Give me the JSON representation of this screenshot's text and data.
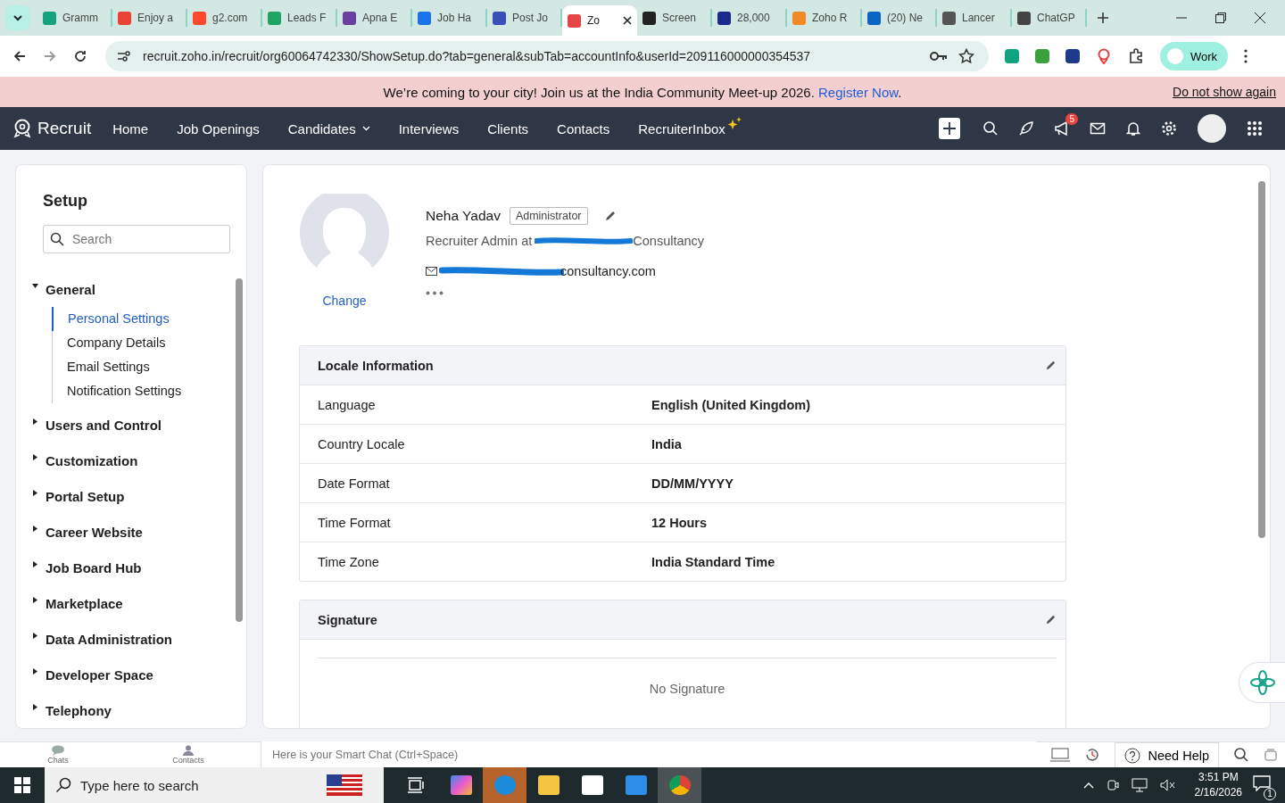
{
  "browser": {
    "tabs": [
      {
        "label": "Gramm",
        "selected": false,
        "color": "#15a37f"
      },
      {
        "label": "Enjoy a",
        "selected": false,
        "color": "#ea4335"
      },
      {
        "label": "g2.com",
        "selected": false,
        "color": "#ff492c"
      },
      {
        "label": "Leads F",
        "selected": false,
        "color": "#1fa463"
      },
      {
        "label": "Apna E",
        "selected": false,
        "color": "#6b3fa0"
      },
      {
        "label": "Job Ha",
        "selected": false,
        "color": "#1a73e8"
      },
      {
        "label": "Post Jo",
        "selected": false,
        "color": "#3b4fb8"
      },
      {
        "label": "Zo",
        "selected": true,
        "color": "#e64545"
      },
      {
        "label": "Screen",
        "selected": false,
        "color": "#222222"
      },
      {
        "label": "28,000",
        "selected": false,
        "color": "#1a2a8a"
      },
      {
        "label": "Zoho R",
        "selected": false,
        "color": "#f08a24"
      },
      {
        "label": "(20) Ne",
        "selected": false,
        "color": "#0a66c2"
      },
      {
        "label": "Lancer",
        "selected": false,
        "color": "#555555"
      },
      {
        "label": "ChatGP",
        "selected": false,
        "color": "#444444"
      }
    ],
    "url": "recruit.zoho.in/recruit/org60064742330/ShowSetup.do?tab=general&subTab=accountInfo&userId=209116000000354537",
    "profile": "Work"
  },
  "banner": {
    "message": "We’re coming to your city! Join us at the India Community Meet-up 2026.",
    "link": "Register Now",
    "end": ".",
    "dismiss": "Do not show again"
  },
  "nav": {
    "brand": "Recruit",
    "items": [
      {
        "label": "Home",
        "kind": "plain"
      },
      {
        "label": "Job Openings",
        "kind": "plain"
      },
      {
        "label": "Candidates",
        "kind": "dropdown"
      },
      {
        "label": "Interviews",
        "kind": "plain"
      },
      {
        "label": "Clients",
        "kind": "plain"
      },
      {
        "label": "Contacts",
        "kind": "plain"
      },
      {
        "label": "RecruiterInbox",
        "kind": "sparkle"
      }
    ],
    "badge": "5"
  },
  "sidebar": {
    "title": "Setup",
    "search_placeholder": "Search",
    "groups": [
      {
        "label": "General",
        "expanded": true,
        "children": [
          {
            "label": "Personal Settings",
            "selected": true
          },
          {
            "label": "Company Details",
            "selected": false
          },
          {
            "label": "Email Settings",
            "selected": false
          },
          {
            "label": "Notification Settings",
            "selected": false
          }
        ]
      },
      {
        "label": "Users and Control",
        "expanded": false
      },
      {
        "label": "Customization",
        "expanded": false
      },
      {
        "label": "Portal Setup",
        "expanded": false
      },
      {
        "label": "Career Website",
        "expanded": false
      },
      {
        "label": "Job Board Hub",
        "expanded": false
      },
      {
        "label": "Marketplace",
        "expanded": false
      },
      {
        "label": "Data Administration",
        "expanded": false
      },
      {
        "label": "Developer Space",
        "expanded": false
      },
      {
        "label": "Telephony",
        "expanded": false
      }
    ]
  },
  "profile": {
    "name": "Neha Yadav",
    "role": "Administrator",
    "change": "Change",
    "title_start": "Recruiter Admin at",
    "title_end": "Consultancy",
    "email_end": "consultancy.com"
  },
  "locale": {
    "title": "Locale Information",
    "rows": [
      {
        "label": "Language",
        "value": "English (United Kingdom)"
      },
      {
        "label": "Country Locale",
        "value": "India"
      },
      {
        "label": "Date Format",
        "value": "DD/MM/YYYY"
      },
      {
        "label": "Time Format",
        "value": "12 Hours"
      },
      {
        "label": "Time Zone",
        "value": "India Standard Time"
      }
    ]
  },
  "signature": {
    "title": "Signature",
    "empty": "No Signature"
  },
  "chat_bar": {
    "chats": "Chats",
    "contacts": "Contacts",
    "placeholder": "Here is your Smart Chat (Ctrl+Space)",
    "help": "Need Help"
  },
  "taskbar": {
    "search_placeholder": "Type here to search",
    "time": "3:51 PM",
    "date": "2/16/2026",
    "notifications": "1"
  }
}
